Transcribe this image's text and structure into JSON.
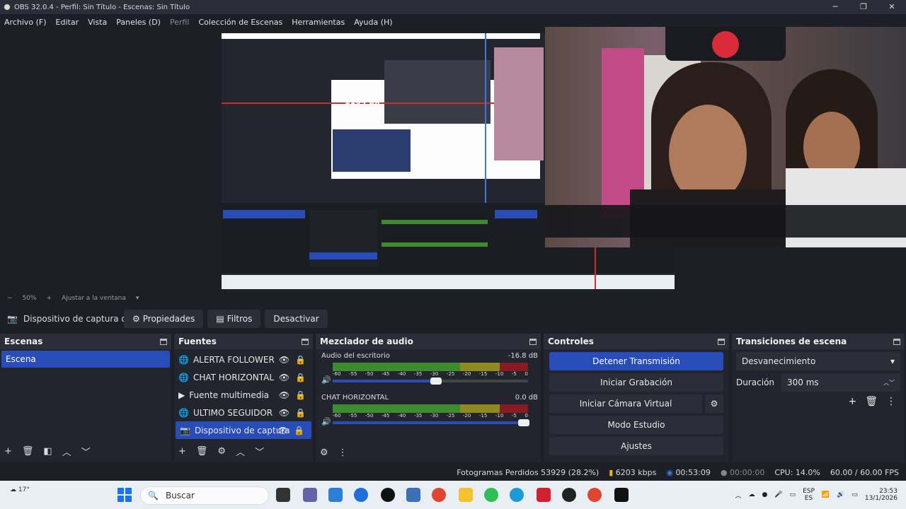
{
  "window": {
    "title": "OBS 32.0.4 - Perfil: Sin Título - Escenas: Sin Título"
  },
  "menu": [
    {
      "label": "Archivo (F)",
      "disabled": false
    },
    {
      "label": "Editar",
      "disabled": false
    },
    {
      "label": "Vista",
      "disabled": false
    },
    {
      "label": "Paneles (D)",
      "disabled": false
    },
    {
      "label": "Perfil",
      "disabled": true
    },
    {
      "label": "Colección de Escenas",
      "disabled": false
    },
    {
      "label": "Herramientas",
      "disabled": false
    },
    {
      "label": "Ayuda (H)",
      "disabled": false
    }
  ],
  "preview": {
    "measure_label": "1164 px"
  },
  "zoombar": {
    "minus": "−",
    "zoom": "50%",
    "plus": "+",
    "fit": "Ajustar a la ventana"
  },
  "sourcebar": {
    "source_name": "Dispositivo de captura de v",
    "properties": "Propiedades",
    "filters": "Filtros",
    "deactivate": "Desactivar"
  },
  "scenes": {
    "title": "Escenas",
    "items": [
      "Escena"
    ]
  },
  "sources": {
    "title": "Fuentes",
    "items": [
      {
        "name": "ALERTA FOLLOWER",
        "icon": "browser-icon"
      },
      {
        "name": "CHAT HORIZONTAL",
        "icon": "browser-icon"
      },
      {
        "name": "Fuente multimedia",
        "icon": "play-icon"
      },
      {
        "name": "ULTIMO SEGUIDOR",
        "icon": "browser-icon"
      },
      {
        "name": "Dispositivo de captura",
        "icon": "camera-icon"
      }
    ]
  },
  "mixer": {
    "title": "Mezclador de audio",
    "channels": [
      {
        "name": "Audio del escritorio",
        "db": "-16.8 dB",
        "level": 0.64
      },
      {
        "name": "CHAT HORIZONTAL",
        "db": "0.0 dB",
        "level": 0.97
      }
    ],
    "scale": [
      "-60",
      "-55",
      "-50",
      "-45",
      "-40",
      "-35",
      "-30",
      "-25",
      "-20",
      "-15",
      "-10",
      "-5",
      "0"
    ]
  },
  "controls": {
    "title": "Controles",
    "stop_stream": "Detener Transmisión",
    "start_record": "Iniciar Grabación",
    "virtual_cam": "Iniciar Cámara Virtual",
    "studio_mode": "Modo Estudio",
    "settings": "Ajustes"
  },
  "transitions": {
    "title": "Transiciones de escena",
    "selected": "Desvanecimiento",
    "duration_label": "Duración",
    "duration_value": "300 ms"
  },
  "status": {
    "dropped": "Fotogramas Perdidos 53929 (28.2%)",
    "bitrate": "6203 kbps",
    "stream_time": "00:53:09",
    "rec_time": "00:00:00",
    "cpu": "CPU: 14.0%",
    "fps": "60.00 / 60.00 FPS"
  },
  "taskbar": {
    "weather": "17°",
    "search_placeholder": "Buscar",
    "lang": "ESP",
    "lang2": "ES",
    "time": "23:53",
    "date": "13/1/2026"
  },
  "colors": {
    "accent": "#284cb8",
    "panel": "#22252d",
    "header": "#2b2e38",
    "bg": "#1d1f26"
  }
}
